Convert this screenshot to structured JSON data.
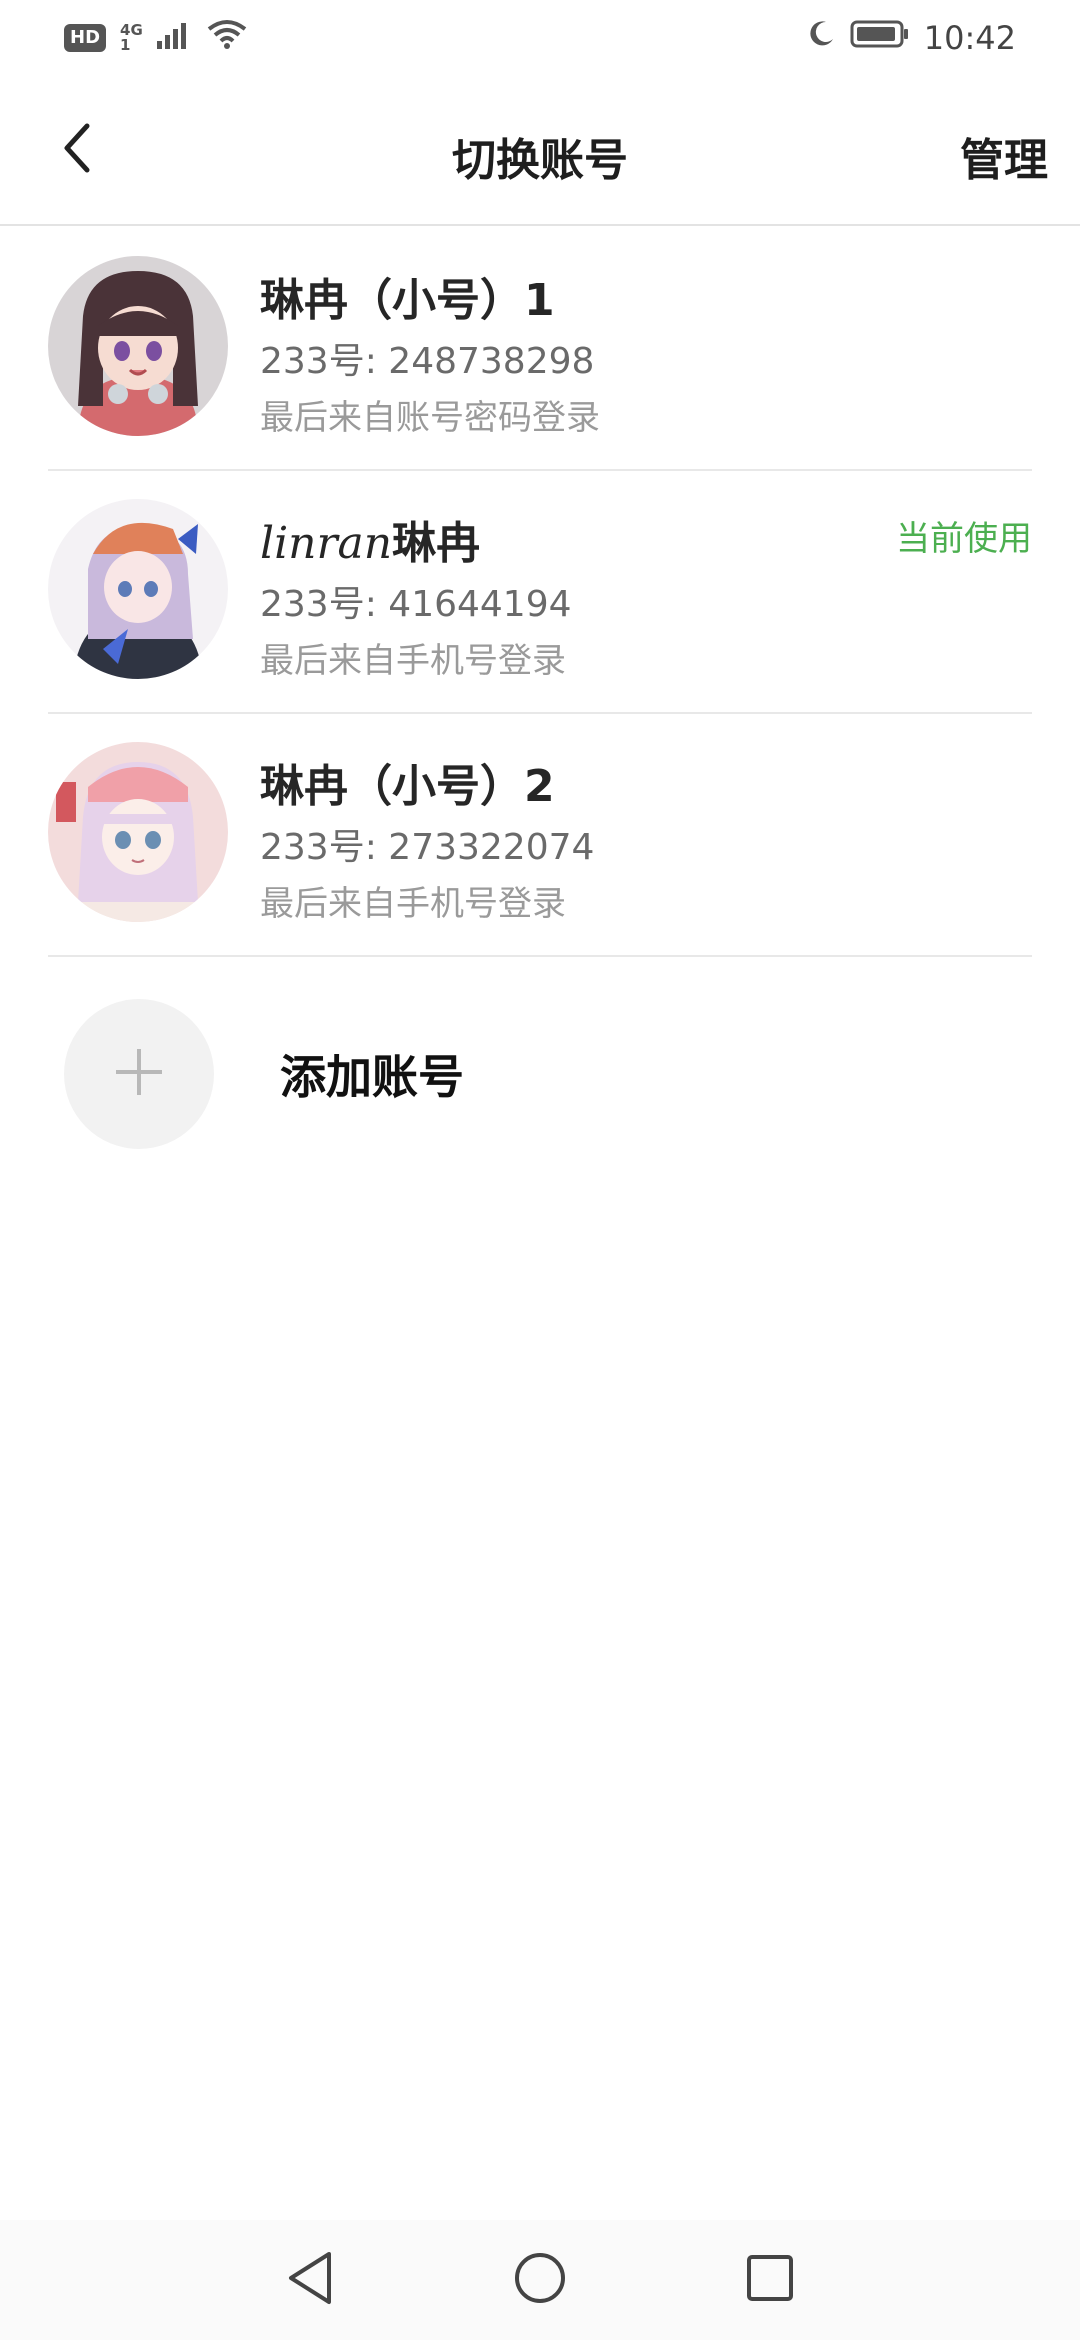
{
  "status_bar": {
    "hd": "HD",
    "network": "4G",
    "network_sub": "1",
    "time": "10:42",
    "icons": [
      "signal-icon",
      "wifi-icon",
      "moon-icon",
      "battery-icon"
    ]
  },
  "header": {
    "title": "切换账号",
    "manage_label": "管理",
    "back_icon": "chevron-left-icon"
  },
  "accounts": [
    {
      "name": "琳冉（小号）1",
      "id_text": "233号: 248738298",
      "login_text": "最后来自账号密码登录",
      "current": false
    },
    {
      "name_italic": "linran",
      "name_rest": "琳冉",
      "id_text": "233号: 41644194",
      "login_text": "最后来自手机号登录",
      "current": true,
      "current_label": "当前使用"
    },
    {
      "name": "琳冉（小号）2",
      "id_text": "233号: 273322074",
      "login_text": "最后来自手机号登录",
      "current": false
    }
  ],
  "add_account": {
    "label": "添加账号",
    "icon": "plus-icon"
  },
  "colors": {
    "accent_green": "#4caf50",
    "divider": "#e8e8e8",
    "add_circle_bg": "#f2f2f2"
  },
  "nav": {
    "icons": [
      "back-triangle-icon",
      "home-circle-icon",
      "recents-square-icon"
    ]
  }
}
